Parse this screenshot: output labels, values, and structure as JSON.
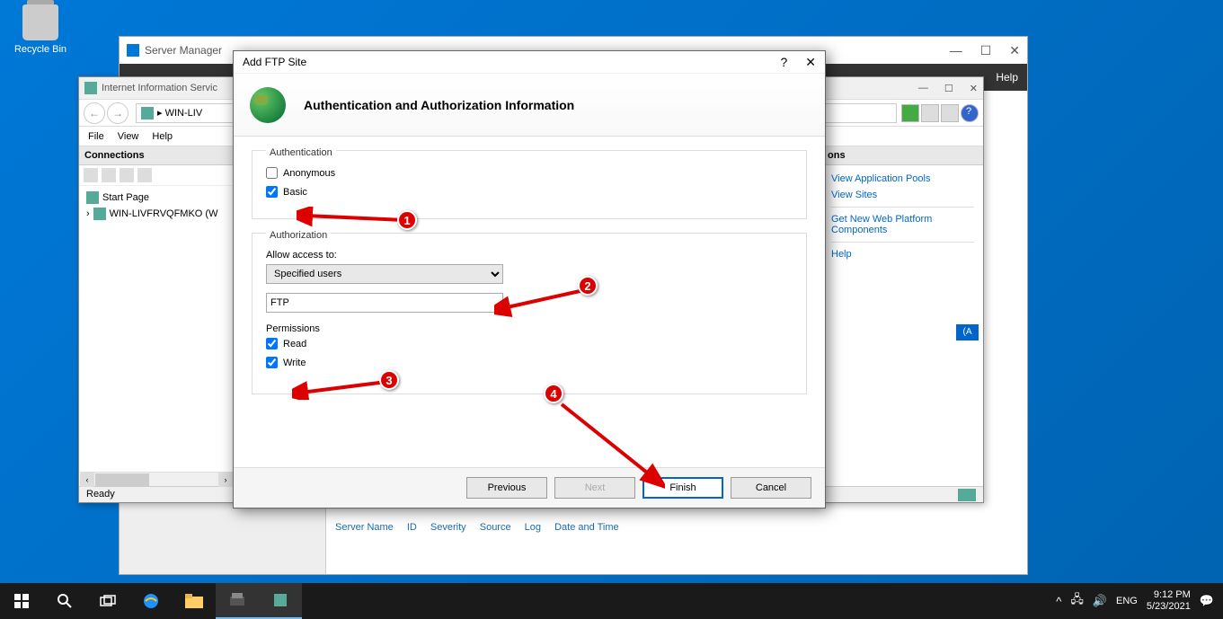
{
  "desktop": {
    "recycle_bin": "Recycle Bin"
  },
  "server_manager": {
    "title": "Server Manager",
    "help": "Help",
    "events": {
      "cols": [
        "Server Name",
        "ID",
        "Severity",
        "Source",
        "Log",
        "Date and Time"
      ]
    }
  },
  "iis": {
    "title": "Internet Information Servic",
    "breadcrumb_arrow": "▸",
    "breadcrumb": "WIN-LIV",
    "menu": {
      "file": "File",
      "view": "View",
      "help": "Help"
    },
    "connections": {
      "header": "Connections",
      "start_page": "Start Page",
      "server": "WIN-LIVFRVQFMKO (W"
    },
    "actions": {
      "header": "ons",
      "view_pools": "View Application Pools",
      "view_sites": "View Sites",
      "get_platform": "Get New Web Platform Components",
      "help": "Help",
      "sel_indicator": "(A"
    },
    "status": "Ready"
  },
  "dialog": {
    "title": "Add FTP Site",
    "header": "Authentication and Authorization Information",
    "auth": {
      "group": "Authentication",
      "anonymous": "Anonymous",
      "anonymous_checked": false,
      "basic": "Basic",
      "basic_checked": true
    },
    "authz": {
      "group": "Authorization",
      "allow_label": "Allow access to:",
      "allow_value": "Specified users",
      "user_value": "FTP",
      "perms_label": "Permissions",
      "read": "Read",
      "read_checked": true,
      "write": "Write",
      "write_checked": true
    },
    "buttons": {
      "previous": "Previous",
      "next": "Next",
      "finish": "Finish",
      "cancel": "Cancel"
    }
  },
  "annotations": {
    "n1": "1",
    "n2": "2",
    "n3": "3",
    "n4": "4"
  },
  "taskbar": {
    "lang": "ENG",
    "time": "9:12 PM",
    "date": "5/23/2021"
  }
}
